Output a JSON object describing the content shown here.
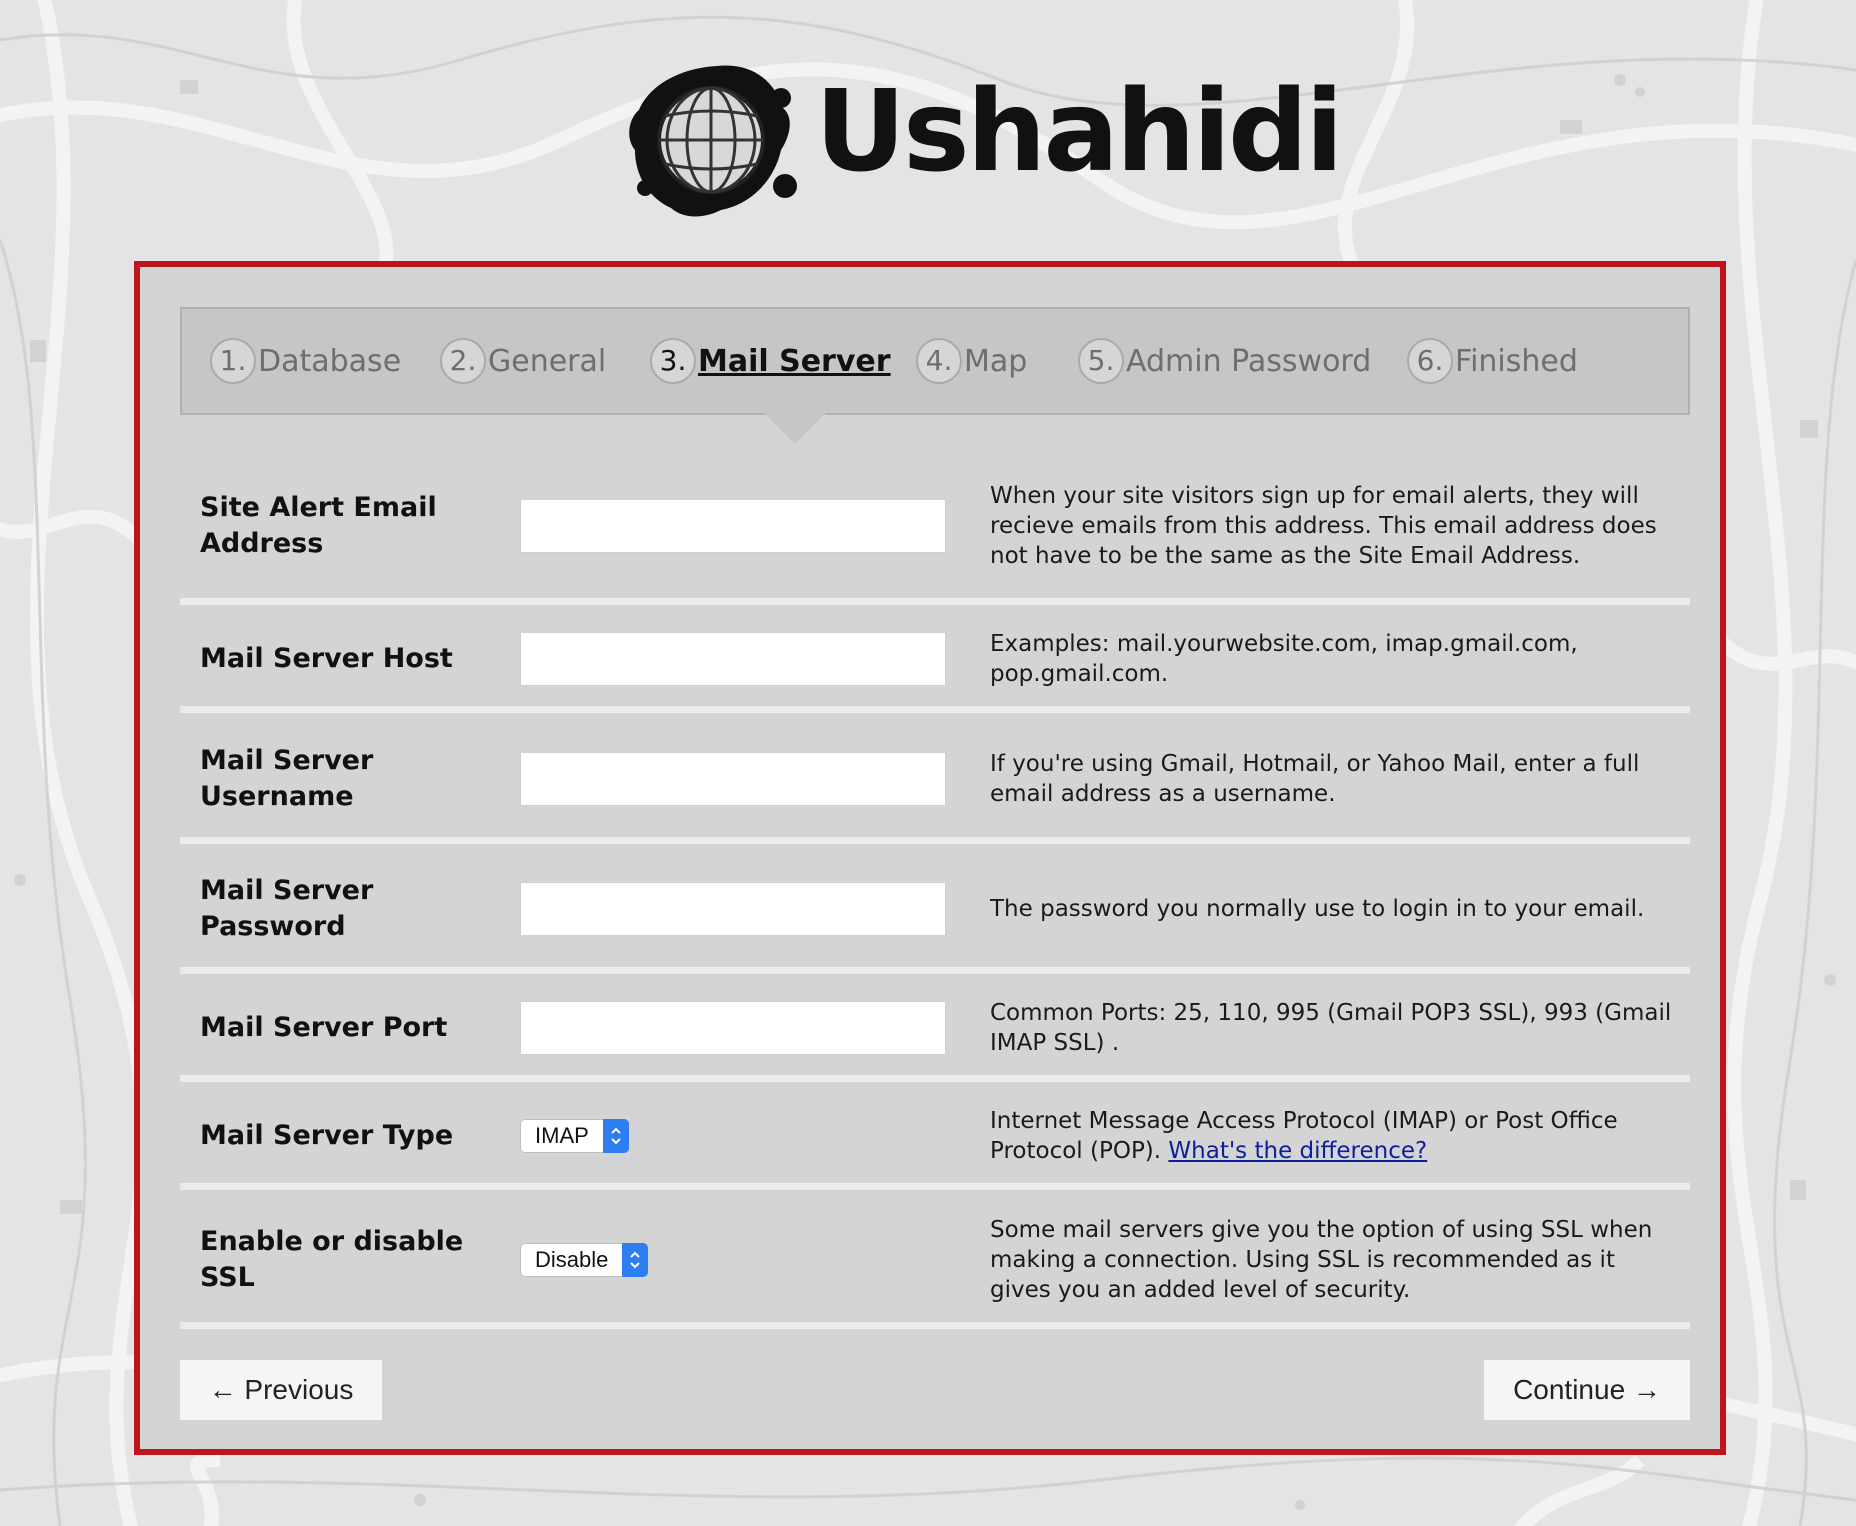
{
  "brand": {
    "name": "Ushahidi"
  },
  "steps": [
    {
      "num": "1.",
      "label": "Database"
    },
    {
      "num": "2.",
      "label": "General"
    },
    {
      "num": "3.",
      "label": "Mail Server"
    },
    {
      "num": "4.",
      "label": "Map"
    },
    {
      "num": "5.",
      "label": "Admin Password"
    },
    {
      "num": "6.",
      "label": "Finished"
    }
  ],
  "active_step": "Mail Server",
  "fields": {
    "alert_email": {
      "label": "Site Alert Email Address",
      "value": "",
      "help": "When your site visitors sign up for email alerts, they will recieve emails from this address. This email address does not have to be the same as the Site Email Address."
    },
    "host": {
      "label": "Mail Server Host",
      "value": "",
      "help": "Examples: mail.yourwebsite.com, imap.gmail.com, pop.gmail.com."
    },
    "username": {
      "label": "Mail Server Username",
      "value": "",
      "help": "If you're using Gmail, Hotmail, or Yahoo Mail, enter a full email address as a username."
    },
    "password": {
      "label": "Mail Server Password",
      "value": "",
      "help": "The password you normally use to login in to your email."
    },
    "port": {
      "label": "Mail Server Port",
      "value": "",
      "help": "Common Ports: 25, 110, 995 (Gmail POP3 SSL), 993 (Gmail IMAP SSL) ."
    },
    "type": {
      "label": "Mail Server Type",
      "selected": "IMAP",
      "help": "Internet Message Access Protocol (IMAP) or Post Office Protocol (POP).",
      "link": "What's the difference?"
    },
    "ssl": {
      "label": "Enable or disable SSL",
      "selected": "Disable",
      "help": "Some mail servers give you the option of using SSL when making a connection. Using SSL is recommended as it gives you an added level of security."
    }
  },
  "buttons": {
    "previous": "← Previous",
    "continue": "Continue →"
  },
  "colors": {
    "accent_border": "#c0141c",
    "select_blue": "#2d7ef0",
    "link": "#0b1f9b"
  },
  "icons": {
    "logo": "globe-splat-logo",
    "select": "updown-chevron-icon"
  }
}
